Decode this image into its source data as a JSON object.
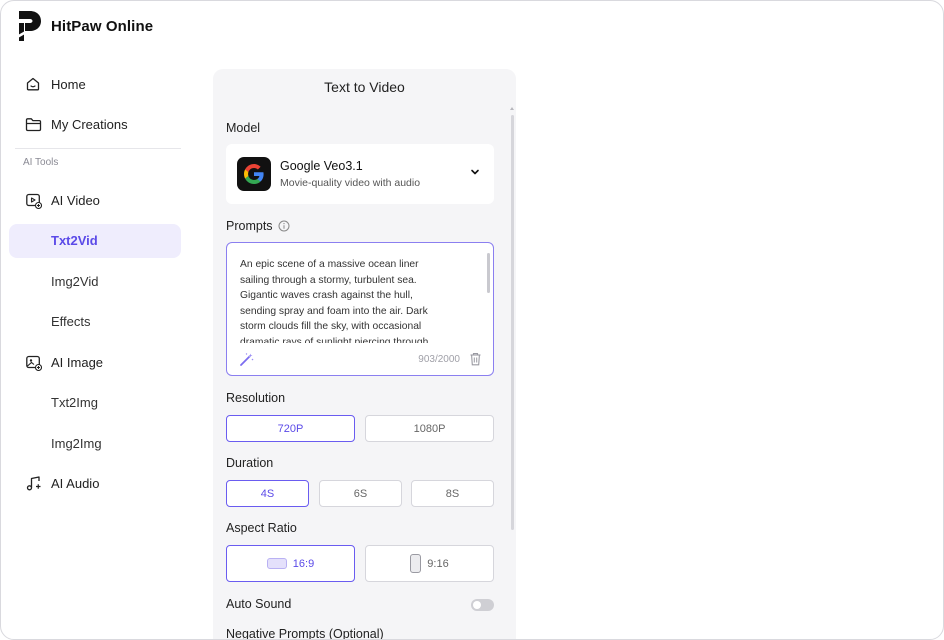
{
  "app": {
    "title": "HitPaw Online"
  },
  "sidebar": {
    "home": "Home",
    "my_creations": "My Creations",
    "section": "AI Tools",
    "ai_video": "AI Video",
    "txt2vid": "Txt2Vid",
    "img2vid": "Img2Vid",
    "effects": "Effects",
    "ai_image": "AI Image",
    "txt2img": "Txt2Img",
    "img2img": "Img2Img",
    "ai_audio": "AI Audio",
    "active_item": "Txt2Vid"
  },
  "panel": {
    "title": "Text to Video",
    "model_label": "Model",
    "model": {
      "name": "Google Veo3.1",
      "description": "Movie-quality video with audio"
    },
    "prompts_label": "Prompts",
    "prompt_lines": [
      "An epic scene of a massive ocean liner",
      "sailing through a stormy, turbulent sea.",
      "Gigantic waves crash against the hull,",
      "sending spray and foam into the air. Dark",
      "storm clouds fill the sky, with occasional",
      "dramatic rays of sunlight piercing through,"
    ],
    "prompt_counter": "903/2000",
    "resolution_label": "Resolution",
    "resolution_options": [
      "720P",
      "1080P"
    ],
    "resolution_selected": "720P",
    "duration_label": "Duration",
    "duration_options": [
      "4S",
      "6S",
      "8S"
    ],
    "duration_selected": "4S",
    "aspect_label": "Aspect Ratio",
    "aspect_options": [
      "16:9",
      "9:16"
    ],
    "aspect_selected": "16:9",
    "auto_sound_label": "Auto Sound",
    "auto_sound_on": false,
    "negative_prompts_label": "Negative Prompts (Optional)"
  },
  "colors": {
    "accent": "#5b4ae8",
    "active_bg": "#efedfd",
    "panel_bg": "#f5f5f7"
  }
}
